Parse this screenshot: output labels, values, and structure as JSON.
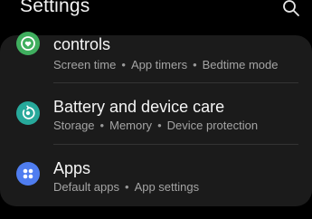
{
  "header": {
    "title": "Settings",
    "search_icon": "search-icon"
  },
  "colors": {
    "background": "#000000",
    "card": "#1b1b1b",
    "digital_wellbeing_icon": "#3fae5e",
    "battery_icon": "#27a99b",
    "apps_icon": "#4f7df0",
    "title_text": "#f5f5f5",
    "subtitle_text": "#a4a4a4"
  },
  "items": [
    {
      "title": "controls",
      "icon": "digital-wellbeing-icon",
      "subtitle": [
        "Screen time",
        "App timers",
        "Bedtime mode"
      ]
    },
    {
      "title": "Battery and device care",
      "icon": "device-care-icon",
      "subtitle": [
        "Storage",
        "Memory",
        "Device protection"
      ]
    },
    {
      "title": "Apps",
      "icon": "apps-icon",
      "subtitle": [
        "Default apps",
        "App settings"
      ]
    }
  ]
}
